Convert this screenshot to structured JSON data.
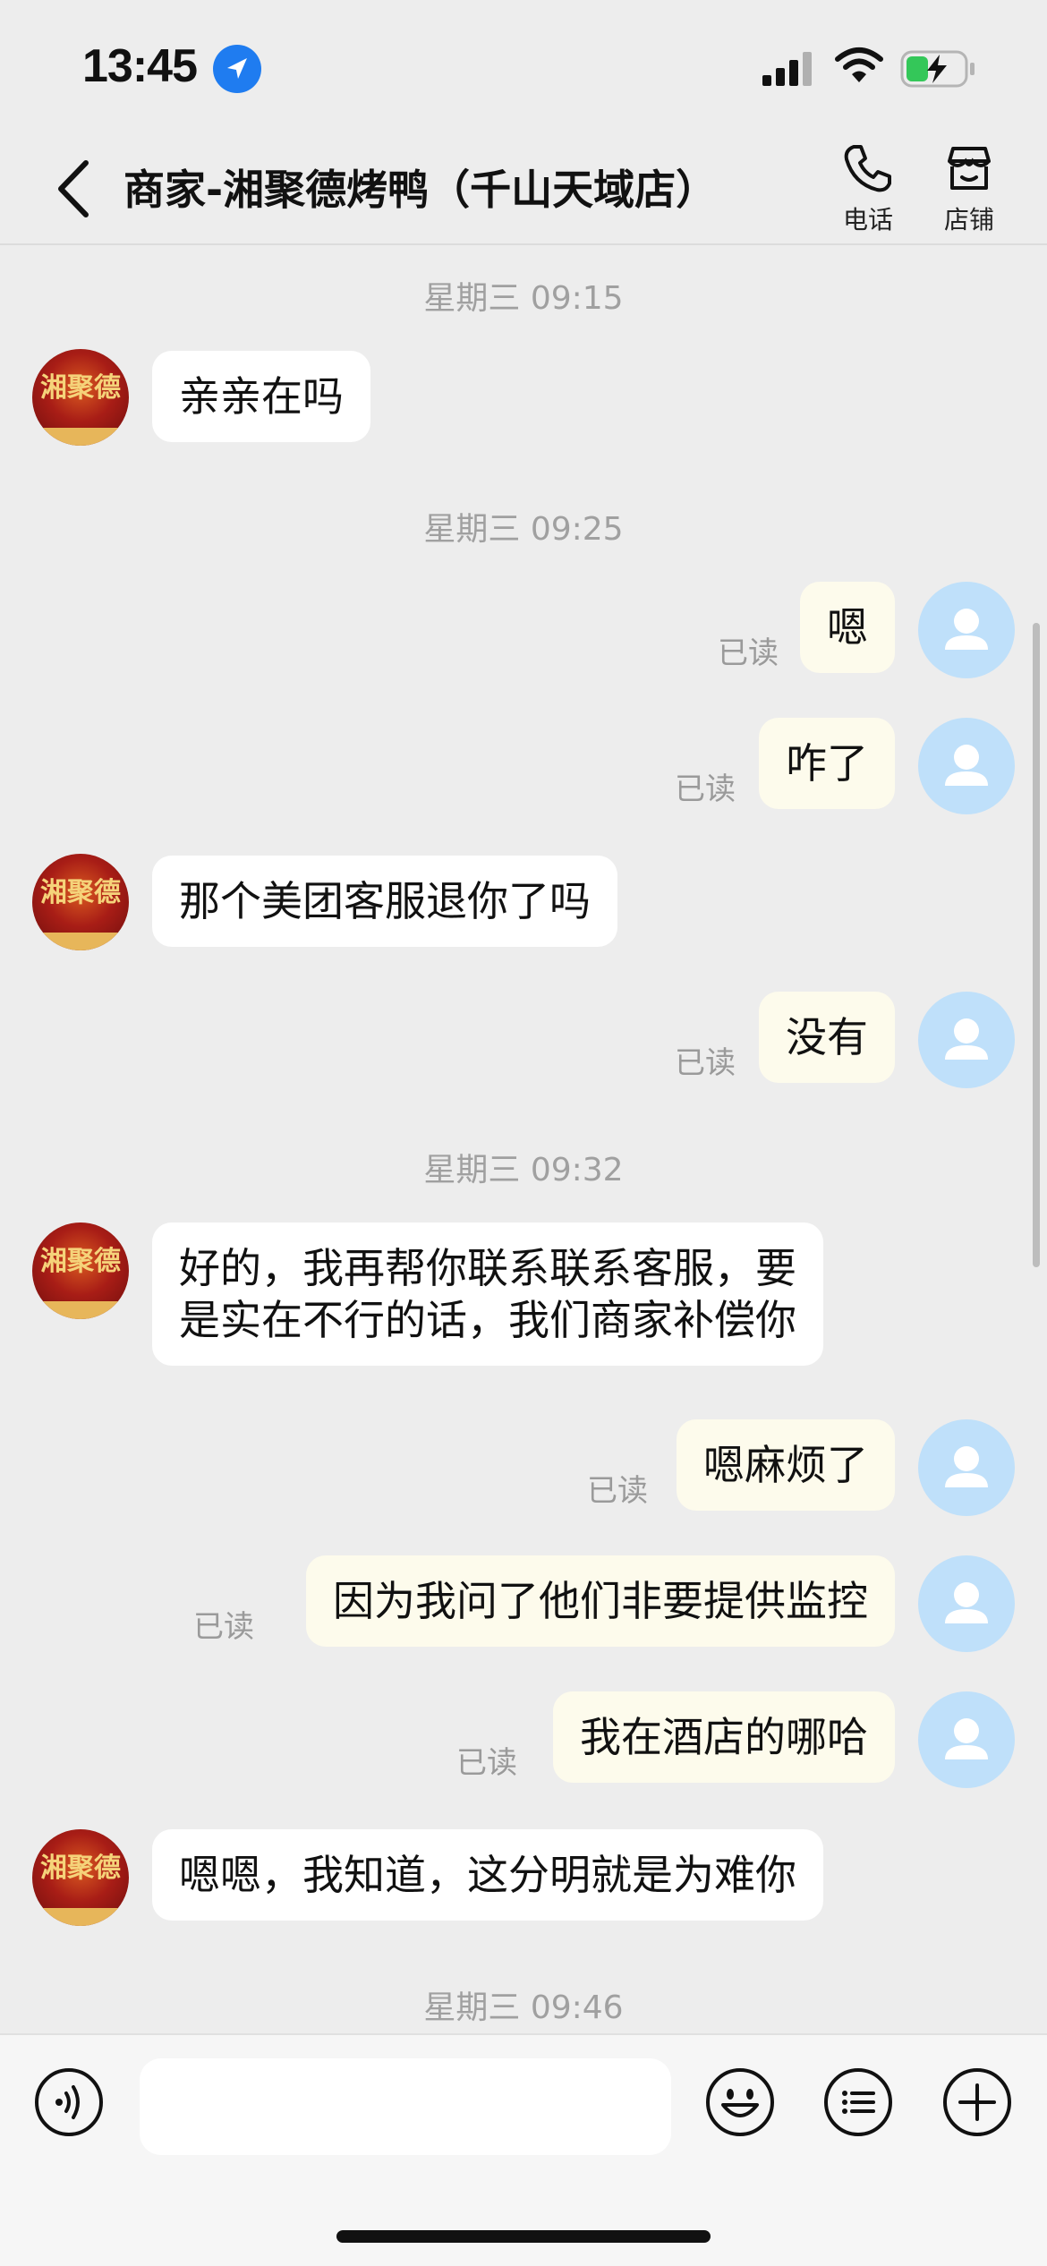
{
  "status_bar": {
    "time": "13:45"
  },
  "nav": {
    "title": "商家-湘聚德烤鸭（千山天域店）",
    "phone_label": "电话",
    "store_label": "店铺"
  },
  "merchant_avatar_logo": "湘聚德",
  "messages": [
    {
      "type": "timestamp",
      "text": "星期三 09:15"
    },
    {
      "type": "in",
      "text": "亲亲在吗"
    },
    {
      "type": "timestamp",
      "text": "星期三 09:25"
    },
    {
      "type": "out",
      "text": "嗯",
      "status": "已读"
    },
    {
      "type": "out",
      "text": "咋了",
      "status": "已读"
    },
    {
      "type": "in",
      "text": "那个美团客服退你了吗"
    },
    {
      "type": "out",
      "text": "没有",
      "status": "已读"
    },
    {
      "type": "timestamp",
      "text": "星期三 09:32"
    },
    {
      "type": "in",
      "lines": [
        "好的，我再帮你联系联系客服，要",
        "是实在不行的话，我们商家补偿你"
      ]
    },
    {
      "type": "out",
      "text": "嗯麻烦了",
      "status": "已读"
    },
    {
      "type": "out",
      "text": "因为我问了他们非要提供监控",
      "status": "已读"
    },
    {
      "type": "out",
      "text": "我在酒店的哪哈",
      "status": "已读"
    },
    {
      "type": "in",
      "text": "嗯嗯，我知道，这分明就是为难你"
    },
    {
      "type": "timestamp",
      "text": "星期三 09:46"
    }
  ],
  "input": {
    "value": ""
  },
  "colors": {
    "background": "#ededed",
    "incoming_bubble": "#ffffff",
    "outgoing_bubble": "#fdfbec",
    "user_avatar": "#bfe0fa",
    "location_icon": "#1f7cf0",
    "battery_charge": "#34c759"
  },
  "icons": [
    "location-arrow-icon",
    "signal-icon",
    "wifi-icon",
    "battery-charging-icon",
    "back-chevron-icon",
    "phone-icon",
    "store-icon",
    "voice-icon",
    "emoji-icon",
    "list-icon",
    "plus-icon",
    "user-avatar-icon"
  ]
}
